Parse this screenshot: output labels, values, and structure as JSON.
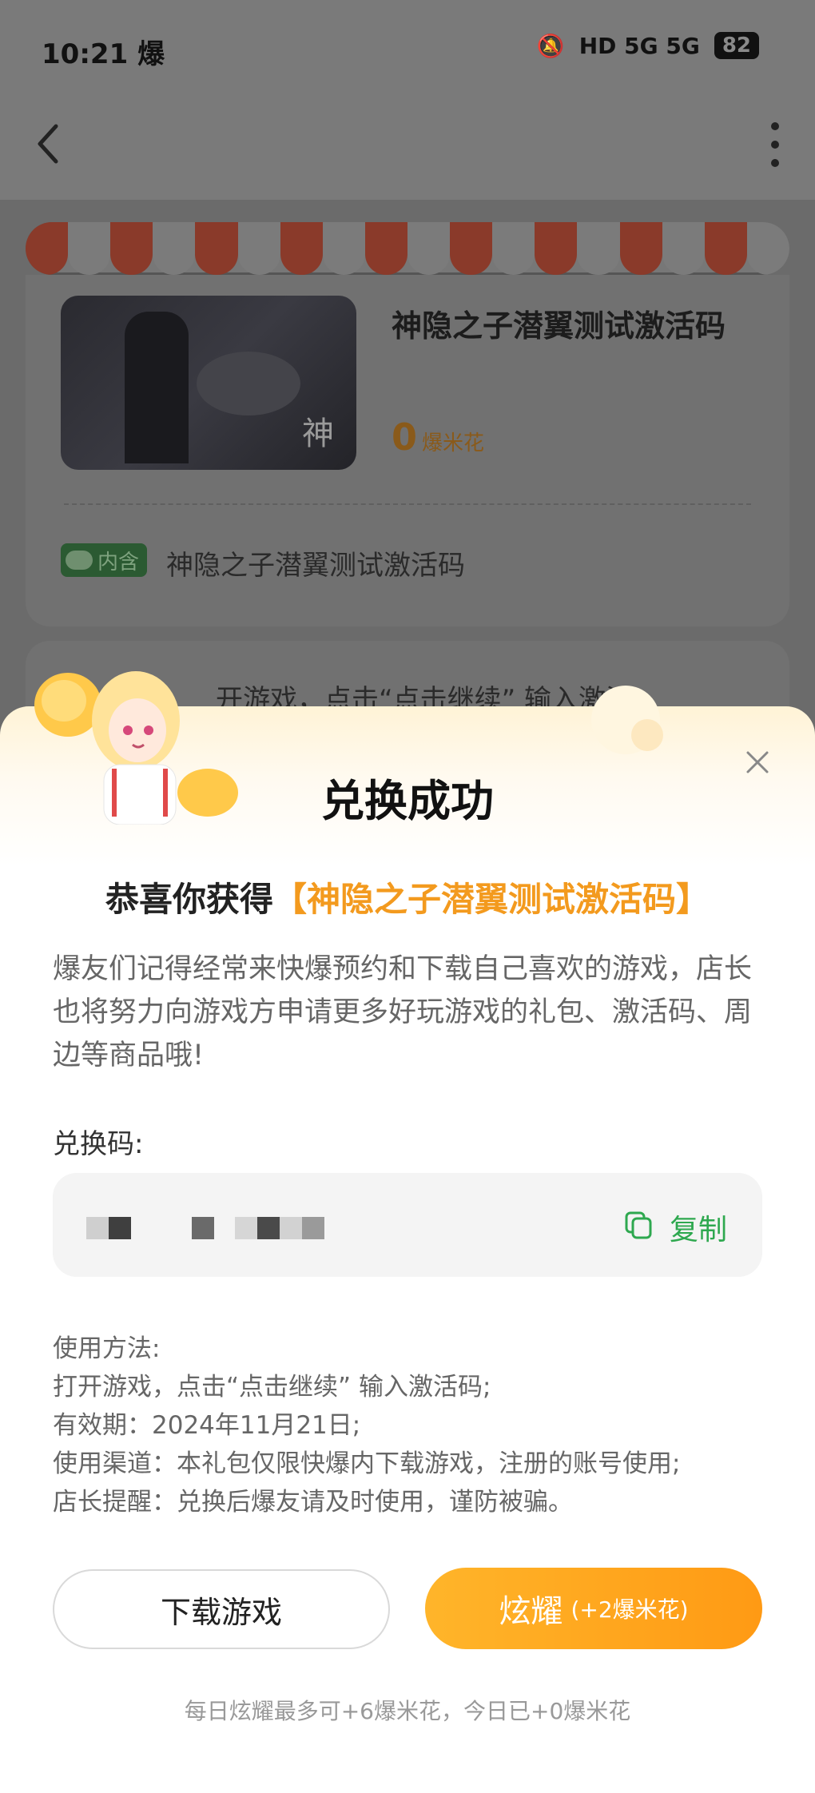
{
  "status_bar": {
    "time": "10:21",
    "app_badge": "爆",
    "battery": "82",
    "signal_text": "HD 5G 5G"
  },
  "product": {
    "title": "神隐之子潜翼测试激活码",
    "price_value": "0",
    "price_unit": "爆米花",
    "inner_badge": "内含",
    "inner_text": "神隐之子潜翼测试激活码"
  },
  "background_card": {
    "text": "开游戏，点击“点击继续” 输入激活"
  },
  "modal": {
    "title": "兑换成功",
    "congrats_prefix": "恭喜你获得",
    "congrats_item": "【神隐之子潜翼测试激活码】",
    "description": "爆友们记得经常来快爆预约和下载自己喜欢的游戏，店长也将努力向游戏方申请更多好玩游戏的礼包、激活码、周边等商品哦!",
    "code_label": "兑换码:",
    "copy_label": "复制",
    "usage": [
      "使用方法:",
      "打开游戏，点击“点击继续” 输入激活码;",
      "有效期：2024年11月21日;",
      "使用渠道：本礼包仅限快爆内下载游戏，注册的账号使用;",
      "店长提醒：兑换后爆友请及时使用，谨防被骗。"
    ],
    "download_button": "下载游戏",
    "show_button": "炫耀",
    "show_button_sub": "(+2爆米花)",
    "footer_note": "每日炫耀最多可+6爆米花，今日已+0爆米花"
  },
  "colors": {
    "accent_orange": "#f39a1e",
    "copy_green": "#2ea84f",
    "button_orange": "#ff9a14"
  }
}
